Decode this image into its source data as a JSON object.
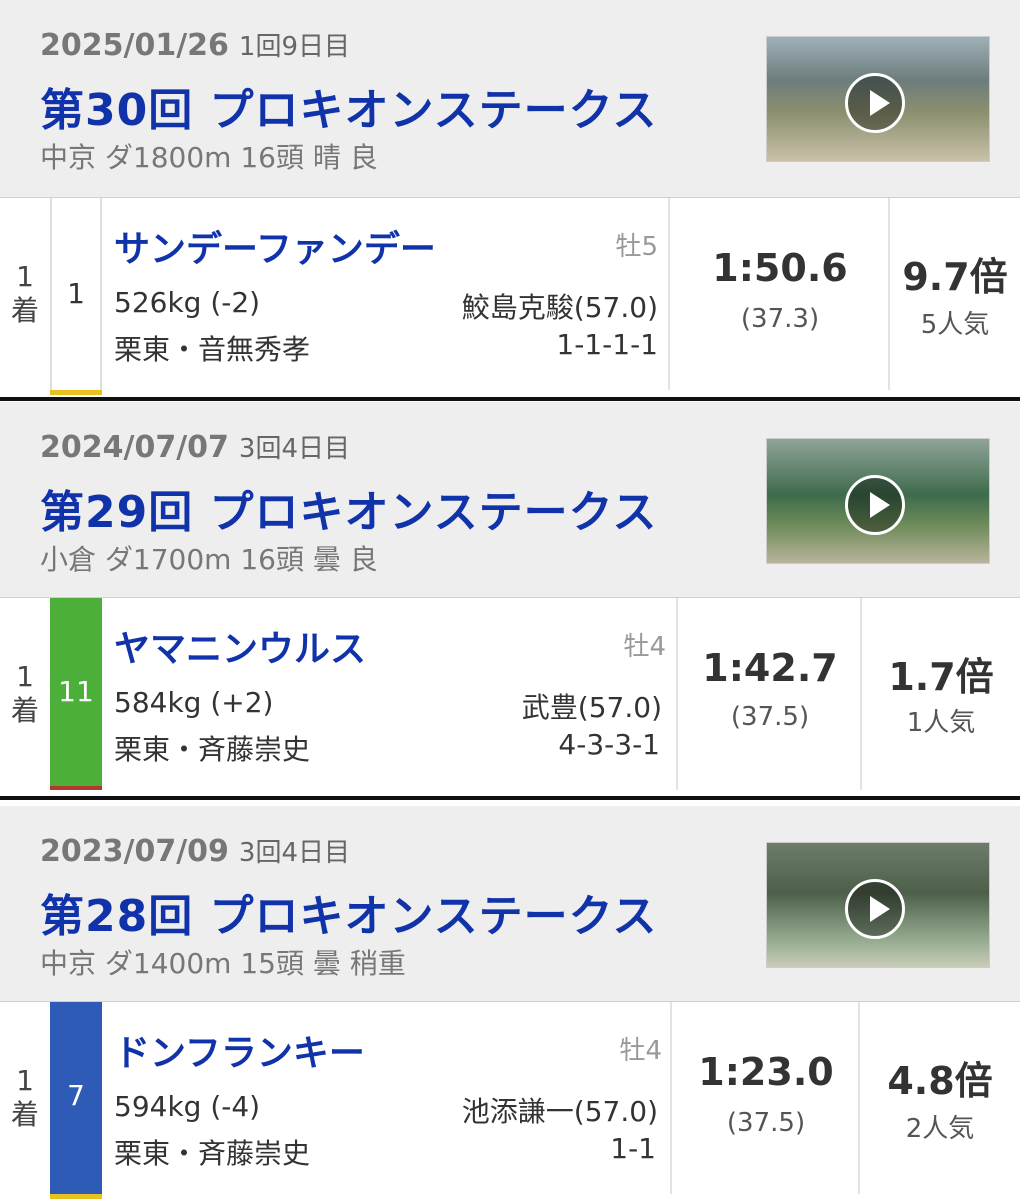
{
  "races": [
    {
      "date": "2025/01/26",
      "kai": "1回9日目",
      "title": "第30回 プロキオンステークス",
      "info": "中京 ダ1800m 16頭 晴 良",
      "result": {
        "rank_num": "1",
        "rank_suffix": "着",
        "gate": "1",
        "gate_color": "#ffffff",
        "gate_text_color": "#333333",
        "horse": "サンデーファンデー",
        "sexage": "牡5",
        "weight": "526kg (-2)",
        "trainer": "栗東・音無秀孝",
        "jockey": "鮫島克駿(57.0)",
        "corners": "1-1-1-1",
        "time": "1:50.6",
        "last3f": "(37.3)",
        "odds": "9.7倍",
        "popularity": "5人気"
      }
    },
    {
      "date": "2024/07/07",
      "kai": "3回4日目",
      "title": "第29回 プロキオンステークス",
      "info": "小倉 ダ1700m 16頭 曇 良",
      "result": {
        "rank_num": "1",
        "rank_suffix": "着",
        "gate": "11",
        "gate_color": "#4caf3a",
        "gate_text_color": "#ffffff",
        "horse": "ヤマニンウルス",
        "sexage": "牡4",
        "weight": "584kg (+2)",
        "trainer": "栗東・斉藤崇史",
        "jockey": "武豊(57.0)",
        "corners": "4-3-3-1",
        "time": "1:42.7",
        "last3f": "(37.5)",
        "odds": "1.7倍",
        "popularity": "1人気"
      }
    },
    {
      "date": "2023/07/09",
      "kai": "3回4日目",
      "title": "第28回 プロキオンステークス",
      "info": "中京 ダ1400m 15頭 曇 稍重",
      "result": {
        "rank_num": "1",
        "rank_suffix": "着",
        "gate": "7",
        "gate_color": "#2d5bb5",
        "gate_text_color": "#ffffff",
        "horse": "ドンフランキー",
        "sexage": "牡4",
        "weight": "594kg (-4)",
        "trainer": "栗東・斉藤崇史",
        "jockey": "池添謙一(57.0)",
        "corners": "1-1",
        "time": "1:23.0",
        "last3f": "(37.5)",
        "odds": "4.8倍",
        "popularity": "2人気"
      }
    }
  ],
  "icons": {
    "video": "play-icon"
  }
}
